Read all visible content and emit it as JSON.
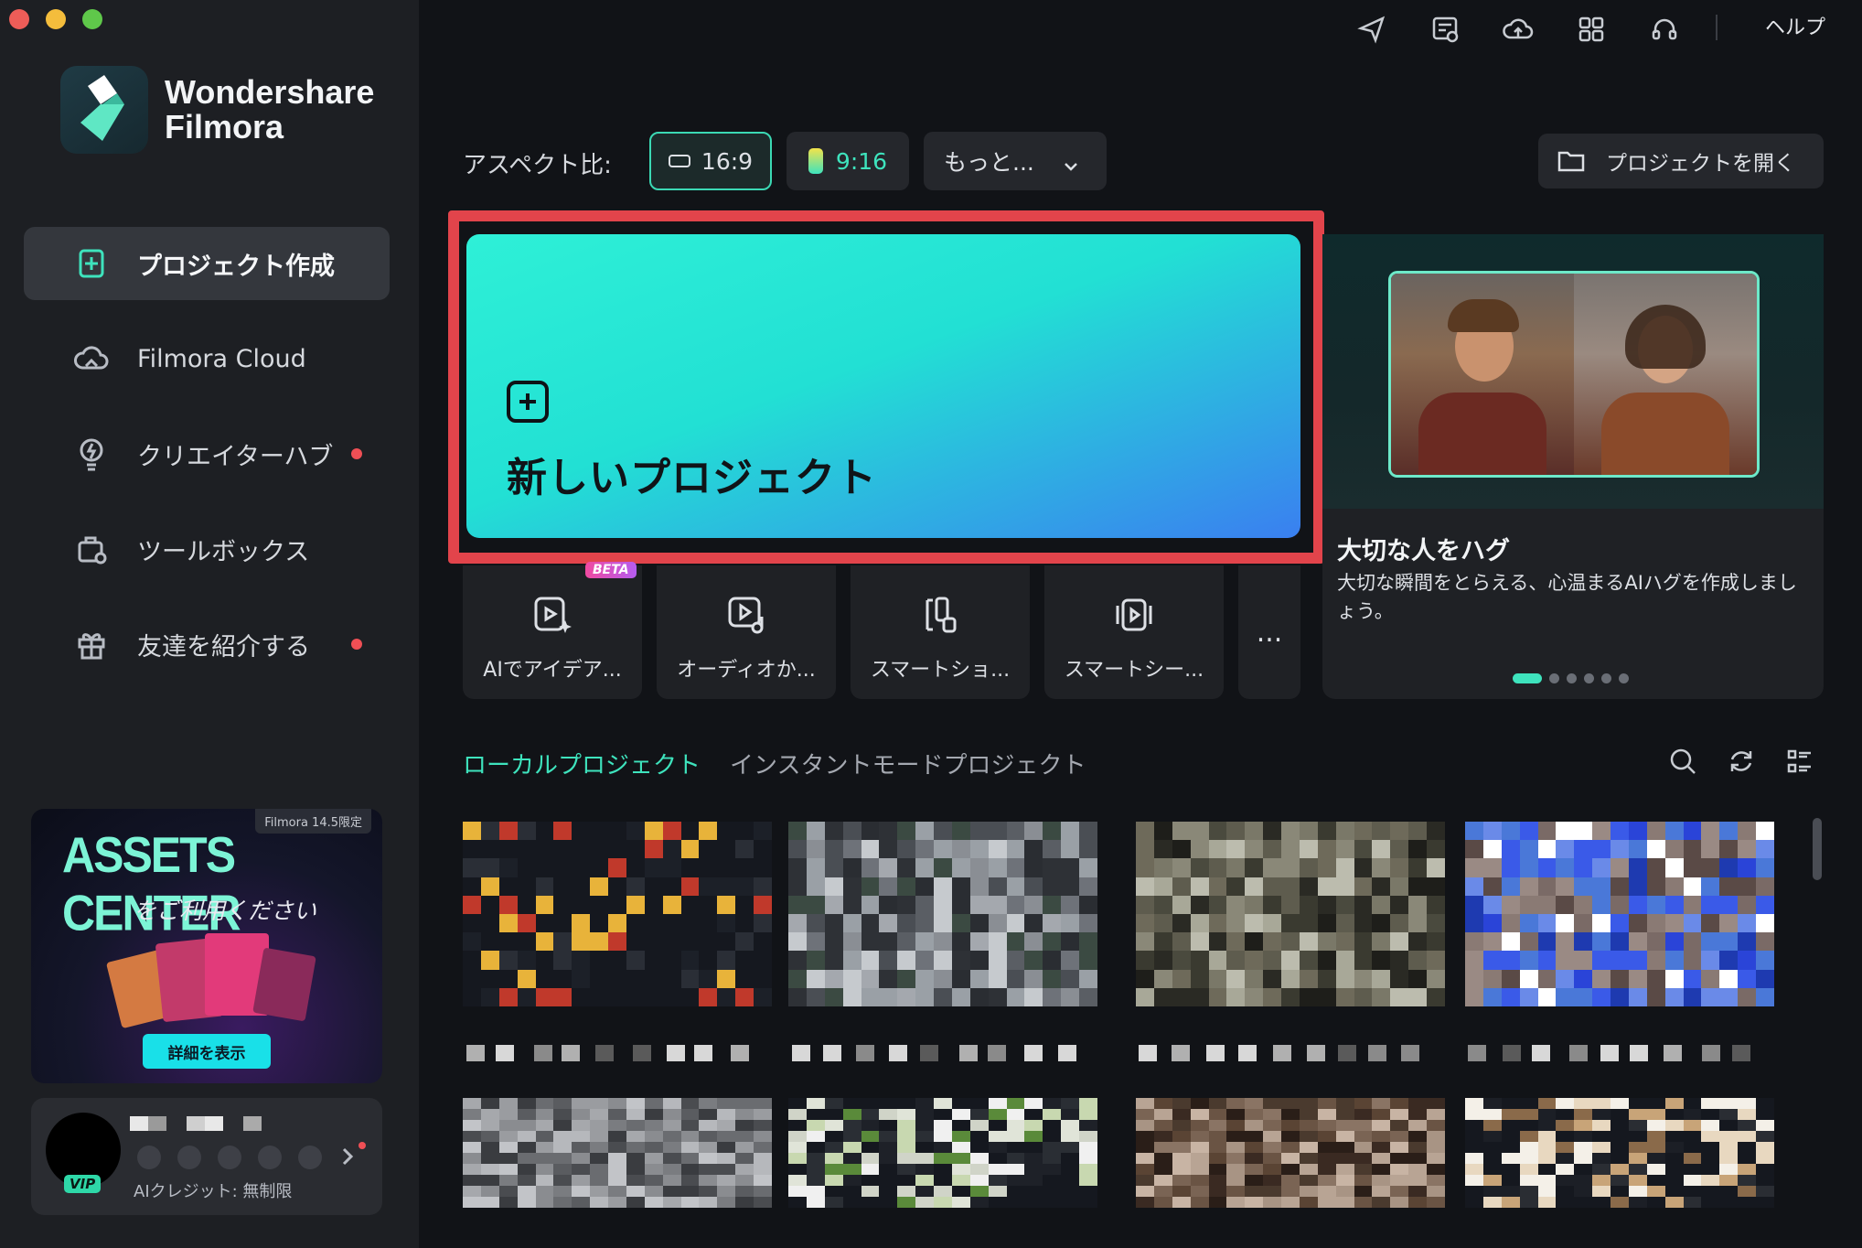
{
  "window": {
    "controls": [
      "close",
      "minimize",
      "maximize"
    ]
  },
  "brand": {
    "line1": "Wondershare",
    "line2": "Filmora"
  },
  "sidebar": {
    "items": [
      {
        "label": "プロジェクト作成",
        "icon": "new-project-icon",
        "active": true,
        "dot": false
      },
      {
        "label": "Filmora Cloud",
        "icon": "cloud-icon",
        "active": false,
        "dot": false
      },
      {
        "label": "クリエイターハブ",
        "icon": "lightbulb-icon",
        "active": false,
        "dot": true
      },
      {
        "label": "ツールボックス",
        "icon": "toolbox-icon",
        "active": false,
        "dot": false
      },
      {
        "label": "友達を紹介する",
        "icon": "gift-icon",
        "active": false,
        "dot": true
      }
    ],
    "assets_banner": {
      "tag": "Filmora 14.5限定",
      "title": "ASSETS CENTER",
      "subtitle": "をご利用ください",
      "button": "詳細を表示"
    },
    "user": {
      "badge": "VIP",
      "credit": "AIクレジット: 無制限"
    }
  },
  "topbar": {
    "icons": [
      "send-icon",
      "feedback-icon",
      "cloud-upload-icon",
      "apps-grid-icon",
      "headset-icon"
    ],
    "help": "ヘルプ"
  },
  "aspect": {
    "label": "アスペクト比:",
    "options": [
      {
        "label": "16:9",
        "selected": true
      },
      {
        "label": "9:16",
        "selected": false
      },
      {
        "label": "もっと...",
        "selected": false
      }
    ],
    "open_project": "プロジェクトを開く"
  },
  "new_project": {
    "label": "新しいプロジェクト"
  },
  "tools": [
    {
      "label": "AIでアイデア...",
      "icon": "ai-idea-icon",
      "badge": "BETA"
    },
    {
      "label": "オーディオか...",
      "icon": "audio-video-icon"
    },
    {
      "label": "スマートショ...",
      "icon": "smart-short-icon"
    },
    {
      "label": "スマートシー...",
      "icon": "smart-scene-icon"
    }
  ],
  "more_tools": "...",
  "promo": {
    "title": "大切な人をハグ",
    "description": "大切な瞬間をとらえる、心温まるAIハグを作成しましょう。",
    "active_slide": 1,
    "slide_count": 6
  },
  "tabs": [
    {
      "label": "ローカルプロジェクト",
      "active": true
    },
    {
      "label": "インスタントモードプロジェクト",
      "active": false
    }
  ],
  "list_tools": [
    "search-icon",
    "refresh-icon",
    "list-view-icon"
  ],
  "colors": {
    "accent": "#3ee3bd",
    "highlight_frame": "#e2444b",
    "alert_dot": "#ef4f55"
  }
}
